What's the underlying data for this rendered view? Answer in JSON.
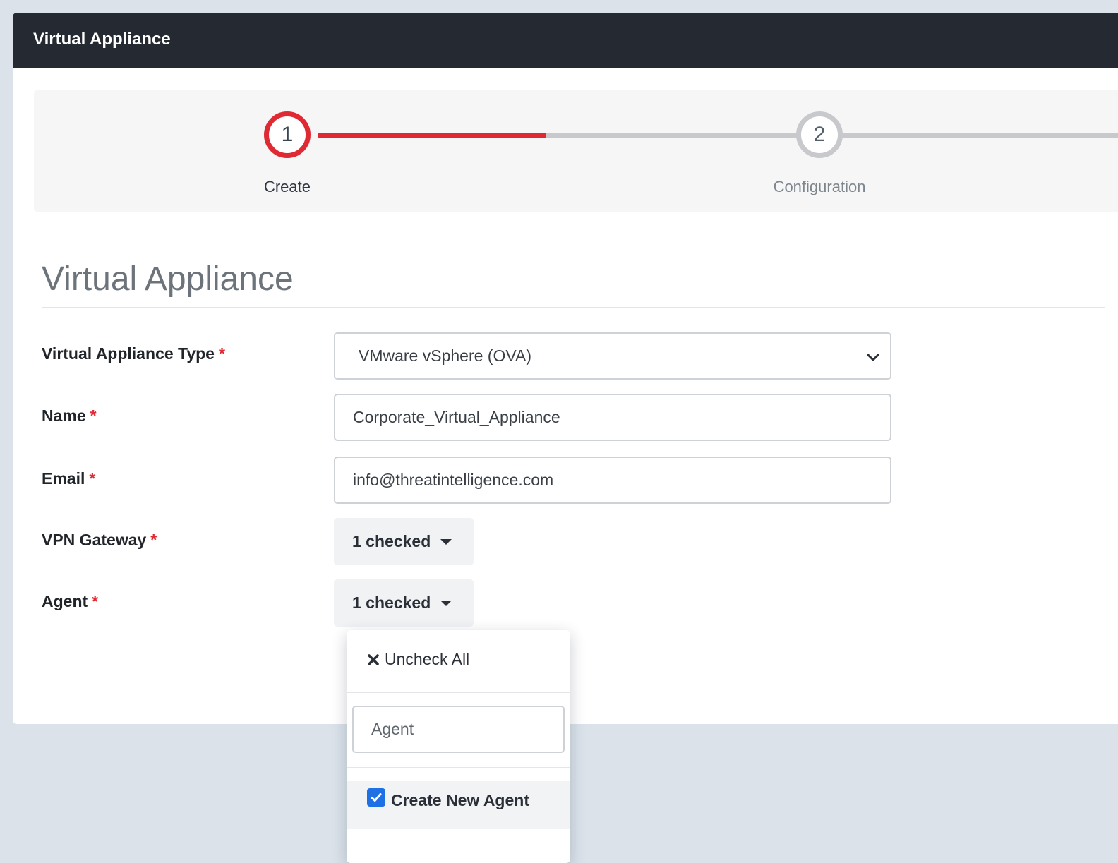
{
  "header": {
    "title": "Virtual Appliance"
  },
  "stepper": {
    "steps": [
      {
        "number": "1",
        "label": "Create"
      },
      {
        "number": "2",
        "label": "Configuration"
      }
    ]
  },
  "form": {
    "section_title": "Virtual Appliance",
    "required_mark": "*",
    "fields": {
      "type": {
        "label": "Virtual Appliance Type",
        "value": "VMware vSphere (OVA)"
      },
      "name": {
        "label": "Name",
        "value": "Corporate_Virtual_Appliance"
      },
      "email": {
        "label": "Email",
        "value": "info@threatintelligence.com"
      },
      "vpn_gateway": {
        "label": "VPN Gateway",
        "value": "1 checked"
      },
      "agent": {
        "label": "Agent",
        "value": "1 checked"
      }
    }
  },
  "agent_dropdown": {
    "uncheck_all_label": "Uncheck All",
    "search_value": "Agent",
    "items": [
      {
        "label": "Create New Agent",
        "checked": true
      }
    ]
  },
  "colors": {
    "accent": "#df2a33",
    "header_bg": "#252932",
    "checkbox": "#1f6fe5"
  }
}
